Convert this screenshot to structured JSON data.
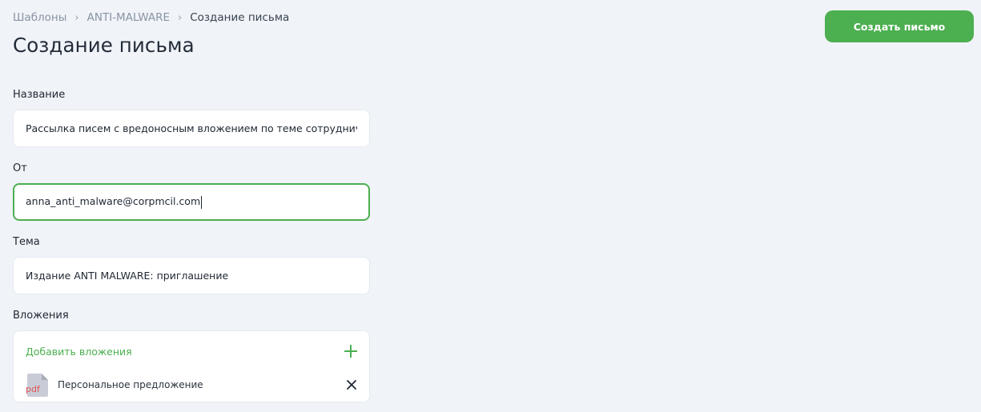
{
  "breadcrumb": {
    "items": [
      "Шаблоны",
      "ANTI-MALWARE",
      "Создание письма"
    ],
    "separator": "›"
  },
  "page": {
    "title": "Создание письма"
  },
  "header": {
    "create_button_label": "Создать письмо"
  },
  "form": {
    "name": {
      "label": "Название",
      "value": "Рассылка писем с вредоносным вложением по теме сотрудниче"
    },
    "from": {
      "label": "От",
      "value": "anna_anti_malware@corpmcil.com"
    },
    "subject": {
      "label": "Тема",
      "value": "Издание ANTI MALWARE: приглашение"
    },
    "attachments": {
      "label": "Вложения",
      "add_label": "Добавить вложения",
      "files": [
        {
          "name": "Персональное предложение",
          "type_label": "pdf",
          "icon": "pdf-file-icon"
        }
      ]
    }
  },
  "colors": {
    "background": "#f0f3f8",
    "accent": "#4caf50",
    "field_bg": "#ffffff",
    "text_primary": "#1f2733",
    "breadcrumb_text": "#8a94a3",
    "pdf_red": "#e05353",
    "file_icon_gray": "#c9ccd6"
  },
  "icons": {
    "breadcrumb_separator": "chevron-right-icon",
    "add_attachment": "plus-icon",
    "remove_attachment": "close-icon"
  }
}
